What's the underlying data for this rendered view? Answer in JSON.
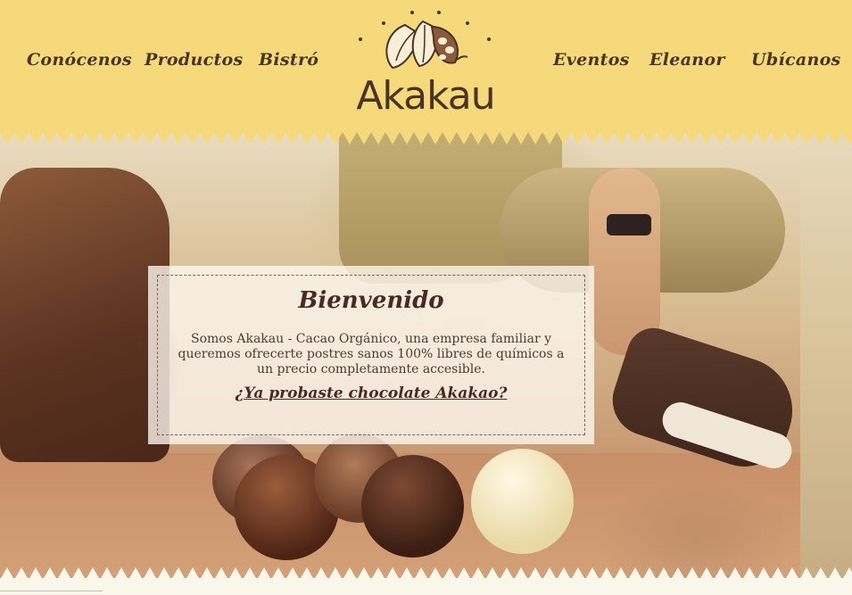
{
  "nav": {
    "left": [
      "Conócenos",
      "Productos",
      "Bistró"
    ],
    "right": [
      "Eventos",
      "Eleanor",
      "Ubícanos"
    ]
  },
  "logo": {
    "text": "Akakau"
  },
  "welcome": {
    "title": "Bienvenido",
    "body": "Somos Akakau - Cacao Orgánico, una empresa familiar y queremos ofrecerte postres sanos 100% libres de químicos a un precio completamente accesible.",
    "link": "¿Ya probaste chocolate Akakao?"
  },
  "colors": {
    "header": "#f6d97a",
    "text": "#4a3326"
  }
}
